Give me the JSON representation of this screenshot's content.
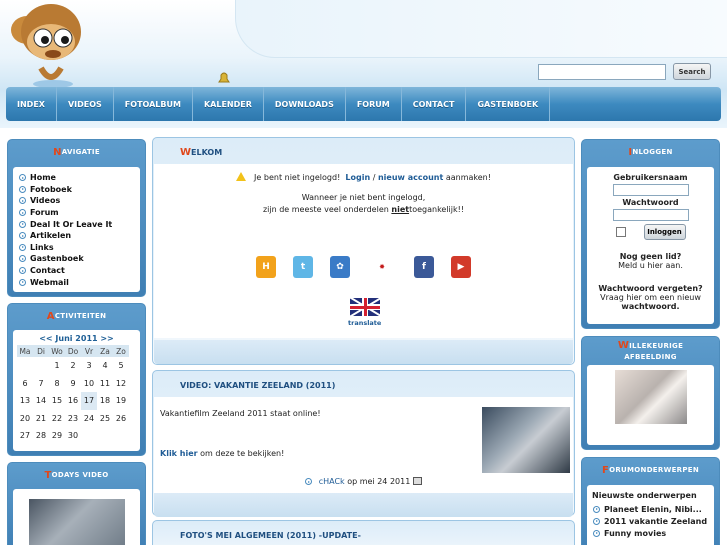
{
  "search": {
    "placeholder": "",
    "button": "Search"
  },
  "nav": [
    "INDEX",
    "VIDEOS",
    "FOTOALBUM",
    "KALENDER",
    "DOWNLOADS",
    "FORUM",
    "CONTACT",
    "GASTENBOEK"
  ],
  "navigatie": {
    "title_first": "N",
    "title_rest": "AVIGATIE",
    "items": [
      "Home",
      "Fotoboek",
      "Videos",
      "Forum",
      "Deal It Or Leave It",
      "Artikelen",
      "Links",
      "Gastenboek",
      "Contact",
      "Webmail"
    ]
  },
  "activiteiten": {
    "title_first": "A",
    "title_rest": "CTIVITEITEN",
    "month": "<< Juni 2011 >>",
    "days": [
      "Ma",
      "Di",
      "Wo",
      "Do",
      "Vr",
      "Za",
      "Zo"
    ],
    "weeks": [
      [
        "",
        "",
        "1",
        "2",
        "3",
        "4",
        "5"
      ],
      [
        "6",
        "7",
        "8",
        "9",
        "10",
        "11",
        "12"
      ],
      [
        "13",
        "14",
        "15",
        "16",
        "17",
        "18",
        "19"
      ],
      [
        "20",
        "21",
        "22",
        "23",
        "24",
        "25",
        "26"
      ],
      [
        "27",
        "28",
        "29",
        "30",
        "",
        "",
        ""
      ]
    ],
    "today": "17"
  },
  "todays_video": {
    "title_first": "T",
    "title_rest": "ODAYS VIDEO"
  },
  "welkom": {
    "title_first": "W",
    "title_rest": "ELKOM",
    "not_logged": "Je bent niet ingelogd!",
    "login": "Login",
    "separator": "/",
    "new_account": "nieuw account",
    "create": "aanmaken!",
    "line1": "Wanneer je niet bent ingelogd,",
    "line2a": "zijn de meeste veel onderdelen",
    "line2b": "niet",
    "line2c": "toegankelijk!!",
    "translate": "translate"
  },
  "video_article": {
    "title": "VIDEO: VAKANTIE ZEELAND (2011)",
    "text": "Vakantiefilm Zeeland 2011 staat online!",
    "click": "Klik hier",
    "click_rest": "om deze te bekijken!",
    "author": "cHACk",
    "date": "op mei 24 2011"
  },
  "photos_article": {
    "title": "FOTO'S MEI ALGEMEEN (2011) -UPDATE-"
  },
  "inloggen": {
    "title_first": "I",
    "title_rest": "NLOGGEN",
    "username": "Gebruikersnaam",
    "password": "Wachtwoord",
    "button": "Inloggen",
    "no_account": "Nog geen lid?",
    "register": "Meld u hier aan.",
    "forgot1": "Wachtwoord vergeten?",
    "forgot2": "Vraag hier om een nieuw",
    "forgot3": "wachtwoord."
  },
  "random_image": {
    "title_first": "W",
    "title_rest": "ILLEKEURIGE",
    "title_line2": "AFBEELDING"
  },
  "forum": {
    "title_first": "F",
    "title_rest": "ORUMONDERWERPEN",
    "heading": "Nieuwste onderwerpen",
    "items": [
      "Planeet Elenin, Nibi...",
      "2011 vakantie Zeeland",
      "Funny movies"
    ]
  },
  "colors": {
    "accent": "#e0481c",
    "nav": "#3d8ac0",
    "link": "#1f5c96"
  }
}
